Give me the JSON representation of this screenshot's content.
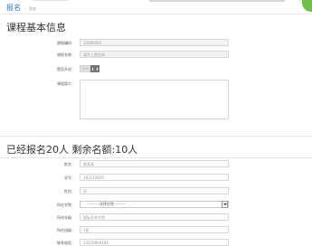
{
  "breadcrumb": {
    "root": "报名",
    "separator": "›",
    "current": "添加"
  },
  "course_section": {
    "title": "课程基本信息",
    "fields": [
      {
        "label": "课程编码：",
        "value": "33008081"
      },
      {
        "label": "课程名称：",
        "value": "填写上报名称"
      },
      {
        "label": "是否开启：",
        "toggle_text": "关闭"
      },
      {
        "label": "课程简介：",
        "value": ""
      }
    ]
  },
  "signup_section": {
    "title": "已经报名20人   剩余名额:10人",
    "fields": [
      {
        "label": "姓名：",
        "value": "黄某某"
      },
      {
        "label": "学号：",
        "value": "182110820"
      },
      {
        "label": "性别：",
        "value": "男"
      },
      {
        "label": "所在学院：",
        "value": "---------选择学院---------"
      },
      {
        "label": "所在年级：",
        "value": "国际关系学院"
      },
      {
        "label": "所在班级：",
        "value": "3班"
      },
      {
        "label": "联系电话：",
        "value": "13219808180"
      }
    ]
  },
  "colors": {
    "accent": "#2a76c6",
    "badge": "#6fbf4a"
  }
}
